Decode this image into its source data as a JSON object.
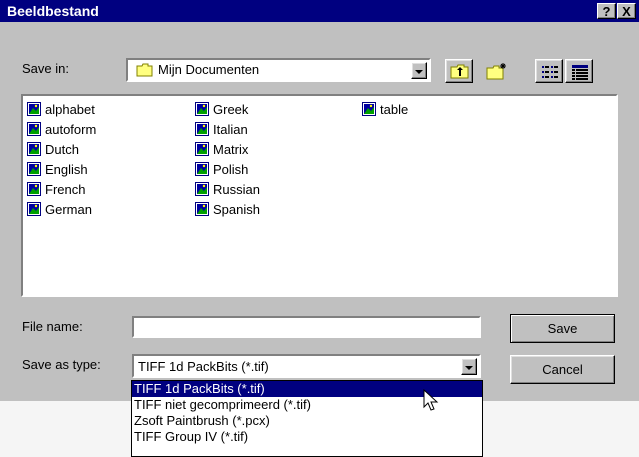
{
  "window": {
    "title": "Beeldbestand"
  },
  "titlebar_buttons": {
    "help": "?",
    "close": "X"
  },
  "save_in": {
    "label": "Save in:",
    "value": "Mijn Documenten"
  },
  "toolbar": {
    "icons": [
      "up-folder-icon",
      "new-folder-icon",
      "list-view-icon",
      "details-view-icon"
    ]
  },
  "files": [
    "alphabet",
    "autoform",
    "Dutch",
    "English",
    "French",
    "German",
    "Greek",
    "Italian",
    "Matrix",
    "Polish",
    "Russian",
    "Spanish",
    "table"
  ],
  "file_name": {
    "label": "File name:",
    "value": ""
  },
  "save_as_type": {
    "label": "Save as type:",
    "value": "TIFF 1d PackBits (*.tif)",
    "options": [
      "TIFF 1d PackBits (*.tif)",
      "TIFF niet gecomprimeerd (*.tif)",
      "Zsoft Paintbrush (*.pcx)",
      "TIFF Group IV (*.tif)"
    ],
    "selected_index": 0
  },
  "buttons": {
    "save": "Save",
    "cancel": "Cancel"
  },
  "colors": {
    "titlebar": "#000080",
    "face": "#c0c0c0",
    "highlight": "#000080"
  }
}
